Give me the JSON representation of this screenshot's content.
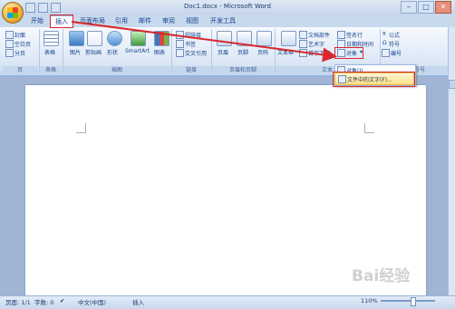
{
  "window": {
    "title": "Doc1.docx - Microsoft Word",
    "controls": [
      "–",
      "□",
      "✕"
    ]
  },
  "tabs": [
    "开始",
    "插入",
    "页面布局",
    "引用",
    "邮件",
    "审阅",
    "视图",
    "开发工具"
  ],
  "ribbon": {
    "pages": {
      "items": [
        "封面",
        "空白页",
        "分页"
      ],
      "group": "页"
    },
    "tables": {
      "label": "表格",
      "group": "表格"
    },
    "illustrations": {
      "items": [
        "图片",
        "剪贴画",
        "形状",
        "SmartArt",
        "图表"
      ],
      "group": "插图"
    },
    "links": {
      "items": [
        "超链接",
        "书签",
        "交叉引用"
      ],
      "group": "链接"
    },
    "header_footer": {
      "items": [
        "页眉",
        "页脚",
        "页码"
      ],
      "group": "页眉和页脚"
    },
    "text": {
      "items": [
        "文本框",
        "文档部件",
        "艺术字",
        "首字下沉",
        "签名行",
        "日期和时间",
        "对象"
      ],
      "group": "文本"
    },
    "symbols": {
      "items": [
        "公式",
        "符号",
        "编号"
      ],
      "group": "特殊符号"
    }
  },
  "menu": {
    "object": "对象(J)...",
    "text_from_file": "文件中的文字(F)..."
  },
  "status": {
    "page": "页面: 1/1",
    "words": "字数: 0",
    "language": "中文(中国)",
    "mode": "插入",
    "zoom": "110%"
  },
  "watermark": "Bai经验"
}
